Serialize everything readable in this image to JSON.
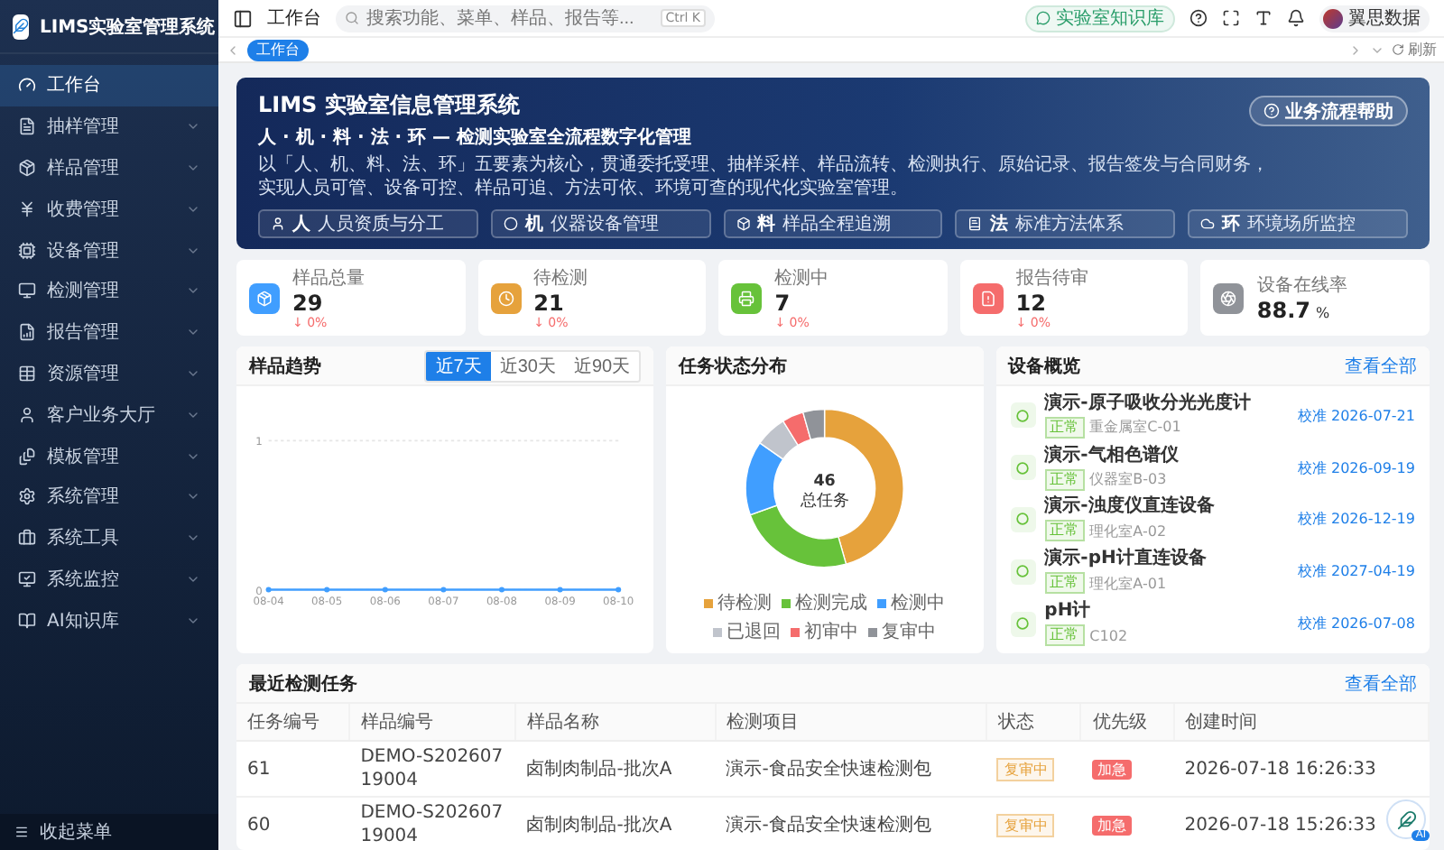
{
  "sidebar": {
    "brand": "LIMS实验室管理系统",
    "items": [
      {
        "label": "工作台",
        "expandable": false,
        "selected": true
      },
      {
        "label": "抽样管理",
        "expandable": true,
        "selected": false
      },
      {
        "label": "样品管理",
        "expandable": true,
        "selected": false
      },
      {
        "label": "收费管理",
        "expandable": true,
        "selected": false
      },
      {
        "label": "设备管理",
        "expandable": true,
        "selected": false
      },
      {
        "label": "检测管理",
        "expandable": true,
        "selected": false
      },
      {
        "label": "报告管理",
        "expandable": true,
        "selected": false
      },
      {
        "label": "资源管理",
        "expandable": true,
        "selected": false
      },
      {
        "label": "客户业务大厅",
        "expandable": true,
        "selected": false
      },
      {
        "label": "模板管理",
        "expandable": true,
        "selected": false
      },
      {
        "label": "系统管理",
        "expandable": true,
        "selected": false
      },
      {
        "label": "系统工具",
        "expandable": true,
        "selected": false
      },
      {
        "label": "系统监控",
        "expandable": true,
        "selected": false
      },
      {
        "label": "AI知识库",
        "expandable": true,
        "selected": false
      }
    ],
    "collapse": "收起菜单"
  },
  "header": {
    "breadcrumb": "工作台",
    "search_placeholder": "搜索功能、菜单、样品、报告等...",
    "shortcut": "Ctrl K",
    "knowledge_button": "实验室知识库",
    "user": "翼思数据"
  },
  "tabs": [
    {
      "label": "工作台",
      "selected": true
    }
  ],
  "refresh": "刷新",
  "banner": {
    "title": "LIMS 实验室信息管理系统",
    "subtitle": "人 · 机 · 料 · 法 · 环 — 检测实验室全流程数字化管理",
    "description": "以「人、机、料、法、环」五要素为核心，贯通委托受理、抽样采样、样品流转、检测执行、原始记录、报告签发与合同财务，实现人员可管、设备可控、样品可追、方法可依、环境可查的现代化实验室管理。",
    "help_button": "业务流程帮助",
    "pillars": [
      {
        "mark": "人",
        "label": "人员资质与分工"
      },
      {
        "mark": "机",
        "label": "仪器设备管理"
      },
      {
        "mark": "料",
        "label": "样品全程追溯"
      },
      {
        "mark": "法",
        "label": "标准方法体系"
      },
      {
        "mark": "环",
        "label": "环境场所监控"
      }
    ]
  },
  "stats": [
    {
      "label": "样品总量",
      "value": "29",
      "change": "↓ 0%",
      "color": "#409eff"
    },
    {
      "label": "待检测",
      "value": "21",
      "change": "↓ 0%",
      "color": "#e6a23c"
    },
    {
      "label": "检测中",
      "value": "7",
      "change": "↓ 0%",
      "color": "#67c23a"
    },
    {
      "label": "报告待审",
      "value": "12",
      "change": "↓ 0%",
      "color": "#f56c6c"
    },
    {
      "label": "设备在线率",
      "value": "88.7",
      "unit": "%",
      "color": "#909399"
    }
  ],
  "trend": {
    "title": "样品趋势",
    "ranges": [
      {
        "label": "近7天",
        "selected": true
      },
      {
        "label": "近30天",
        "selected": false
      },
      {
        "label": "近90天",
        "selected": false
      }
    ],
    "chart_data": {
      "type": "line",
      "categories": [
        "08-04",
        "08-05",
        "08-06",
        "08-07",
        "08-08",
        "08-09",
        "08-10"
      ],
      "series": [
        {
          "color": "#409eff",
          "marker": true,
          "values": [
            0,
            0,
            0,
            0,
            0,
            0,
            0
          ]
        }
      ],
      "ylim": [
        0,
        1
      ],
      "yticks": [
        0,
        1
      ]
    }
  },
  "distribution": {
    "title": "任务状态分布",
    "total": "46",
    "total_label": "总任务",
    "chart_data": {
      "type": "donut",
      "categories": [
        "待检测",
        "检测完成",
        "检测中",
        "已退回",
        "初审中",
        "复审中"
      ],
      "values": [
        45.6,
        23.9,
        15.2,
        6.5,
        4.4,
        4.4
      ],
      "colors": [
        "#e6a23c",
        "#67c23a",
        "#409eff",
        "#c0c4cc",
        "#f56c6c",
        "#909399"
      ]
    }
  },
  "devices": {
    "title": "设备概览",
    "link": "查看全部",
    "items": [
      {
        "name": "演示-原子吸收分光光度计",
        "status": "正常",
        "location": "重金属室C-01",
        "calibration": "校准 2026-07-21"
      },
      {
        "name": "演示-气相色谱仪",
        "status": "正常",
        "location": "仪器室B-03",
        "calibration": "校准 2026-09-19"
      },
      {
        "name": "演示-浊度仪直连设备",
        "status": "正常",
        "location": "理化室A-02",
        "calibration": "校准 2026-12-19"
      },
      {
        "name": "演示-pH计直连设备",
        "status": "正常",
        "location": "理化室A-01",
        "calibration": "校准 2027-04-19"
      },
      {
        "name": "pH计",
        "status": "正常",
        "location": "C102",
        "calibration": "校准 2026-07-08"
      }
    ]
  },
  "tasks": {
    "title": "最近检测任务",
    "link": "查看全部",
    "columns": [
      "任务编号",
      "样品编号",
      "样品名称",
      "检测项目",
      "状态",
      "优先级",
      "创建时间"
    ],
    "rows": [
      {
        "task_id": "61",
        "sample_id": "DEMO-S20260719004",
        "sample_name": "卤制肉制品-批次A",
        "item": "演示-食品安全快速检测包",
        "status": "复审中",
        "priority": "加急",
        "created": "2026-07-18 16:26:33"
      },
      {
        "task_id": "60",
        "sample_id": "DEMO-S20260719004",
        "sample_name": "卤制肉制品-批次A",
        "item": "演示-食品安全快速检测包",
        "status": "复审中",
        "priority": "加急",
        "created": "2026-07-18 15:26:33"
      }
    ]
  },
  "ai_badge": "AI"
}
